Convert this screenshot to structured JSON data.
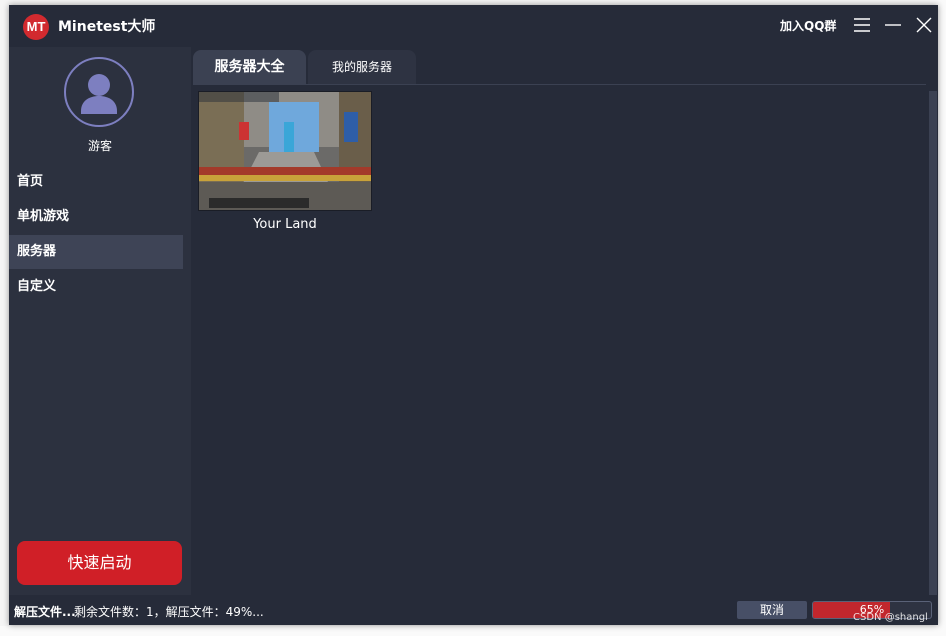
{
  "app": {
    "logo_text": "MT",
    "title": "Minetest大师",
    "join_qq": "加入QQ群"
  },
  "window_controls": [
    "menu-icon",
    "minimize-icon",
    "close-icon"
  ],
  "sidebar": {
    "user_name": "游客",
    "items": [
      {
        "label": "首页",
        "active": false
      },
      {
        "label": "单机游戏",
        "active": false
      },
      {
        "label": "服务器",
        "active": true
      },
      {
        "label": "自定义",
        "active": false
      }
    ],
    "quick_start": "快速启动"
  },
  "tabs": [
    {
      "label": "服务器大全",
      "active": true
    },
    {
      "label": "我的服务器",
      "active": false
    }
  ],
  "servers": [
    {
      "name": "Your Land"
    }
  ],
  "status": {
    "action": "解压文件...",
    "detail": "剩余文件数：1，解压文件：49%...",
    "cancel": "取消",
    "progress_text": "65%",
    "progress": 0.65
  },
  "watermark": "CSDN @shangl",
  "colors": {
    "accent": "#d01f27",
    "bg": "#262b39",
    "sidebar": "#2c313f",
    "active": "#3e4456"
  }
}
